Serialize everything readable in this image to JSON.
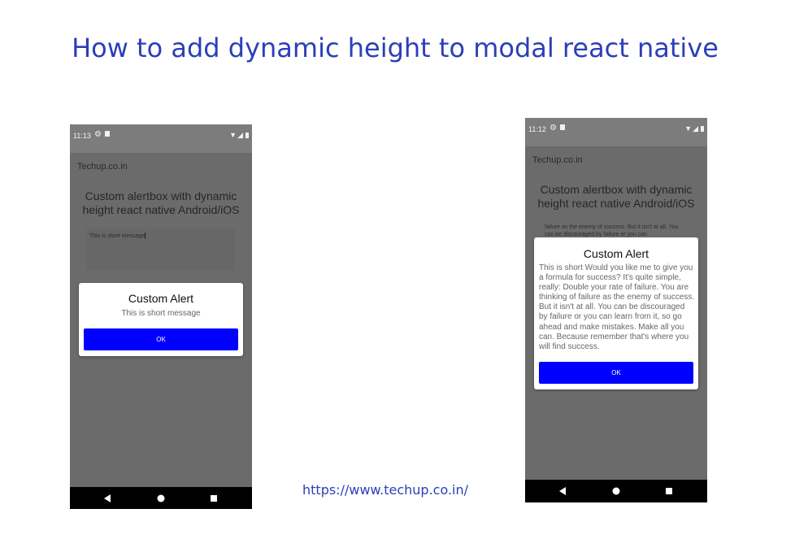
{
  "page": {
    "title": "How to add dynamic height to modal react native",
    "url": "https://www.techup.co.in/"
  },
  "phones": {
    "left": {
      "status_time": "11:13",
      "header": "Techup.co.in",
      "app_title": "Custom alertbox with dynamic height react native Android/iOS",
      "input_value": "This is short message",
      "alert_title": "Custom Alert",
      "alert_message": "This is short message",
      "ok_label": "OK"
    },
    "right": {
      "status_time": "11:12",
      "header": "Techup.co.in",
      "app_title": "Custom alertbox with dynamic height react native Android/iOS",
      "background_text": "failure as the enemy of success. But it isn't at all. You can be discouraged by failure or you can",
      "alert_title": "Custom Alert",
      "alert_message": "This is short Would you like me to give you a formula for success? It's quite simple, really: Double your rate of failure. You are thinking of failure as the enemy of success. But it isn't at all. You can be discouraged by failure or you can learn from it, so go ahead and make mistakes. Make all you can. Because remember that's where you will find success.",
      "ok_label": "OK"
    }
  },
  "colors": {
    "title": "#2b3fb8",
    "ok_button": "#0000ff",
    "overlay": "#6b6b6b"
  },
  "icons": {
    "status": [
      "gear-icon",
      "sd-card-icon",
      "wifi-icon",
      "signal-icon",
      "battery-icon"
    ],
    "nav": [
      "back-icon",
      "home-icon",
      "recent-apps-icon"
    ]
  }
}
